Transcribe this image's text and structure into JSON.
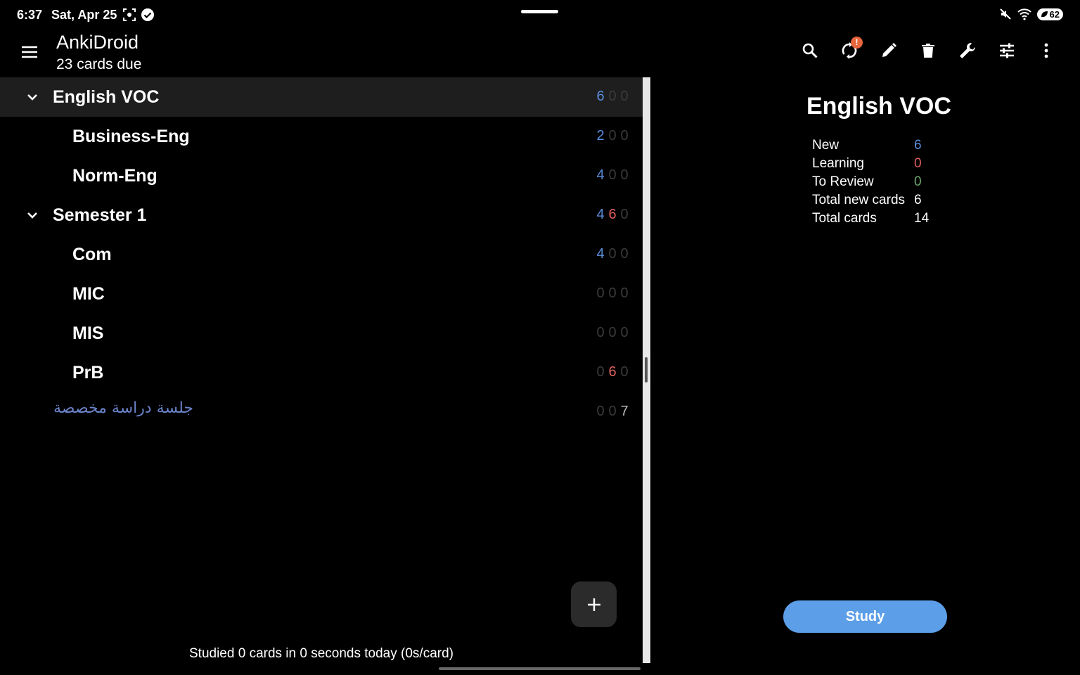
{
  "status_bar": {
    "time": "6:37",
    "date": "Sat, Apr 25",
    "battery": "62"
  },
  "app_bar": {
    "title": "AnkiDroid",
    "subtitle": "23 cards due",
    "sync_badge": "!",
    "icons": [
      "search-icon",
      "sync-icon",
      "edit-icon",
      "delete-icon",
      "wrench-icon",
      "sliders-icon",
      "more-vert-icon"
    ]
  },
  "decks": [
    {
      "name": "English VOC",
      "level": "parent",
      "expanded": true,
      "selected": true,
      "counts": [
        "6",
        "0",
        "0"
      ]
    },
    {
      "name": "Business-Eng",
      "level": "child",
      "counts": [
        "2",
        "0",
        "0"
      ]
    },
    {
      "name": "Norm-Eng",
      "level": "child",
      "counts": [
        "4",
        "0",
        "0"
      ]
    },
    {
      "name": "Semester 1",
      "level": "parent",
      "expanded": true,
      "counts": [
        "4",
        "6",
        "0"
      ]
    },
    {
      "name": "Com",
      "level": "child",
      "counts": [
        "4",
        "0",
        "0"
      ]
    },
    {
      "name": "MIC",
      "level": "child",
      "counts": [
        "0",
        "0",
        "0"
      ]
    },
    {
      "name": "MIS",
      "level": "child",
      "counts": [
        "0",
        "0",
        "0"
      ]
    },
    {
      "name": "PrB",
      "level": "child",
      "counts": [
        "0",
        "6",
        "0"
      ]
    },
    {
      "name": "جلسة دراسة مخصصة",
      "level": "filtered",
      "counts": [
        "0",
        "0",
        "7"
      ]
    }
  ],
  "footer": {
    "studied": "Studied 0 cards in 0 seconds today (0s/card)",
    "fab_label": "+"
  },
  "detail": {
    "title": "English VOC",
    "stats": [
      {
        "label": "New",
        "value": "6",
        "kind": "new"
      },
      {
        "label": "Learning",
        "value": "0",
        "kind": "learn"
      },
      {
        "label": "To Review",
        "value": "0",
        "kind": "review"
      },
      {
        "label": "Total new cards",
        "value": "6",
        "kind": "plain"
      },
      {
        "label": "Total cards",
        "value": "14",
        "kind": "plain"
      }
    ],
    "study_label": "Study"
  },
  "colors": {
    "new": "#5a8ede",
    "learning": "#e06060",
    "review": "#6fa86f",
    "accent": "#5c9ee8",
    "badge": "#e8663d"
  }
}
